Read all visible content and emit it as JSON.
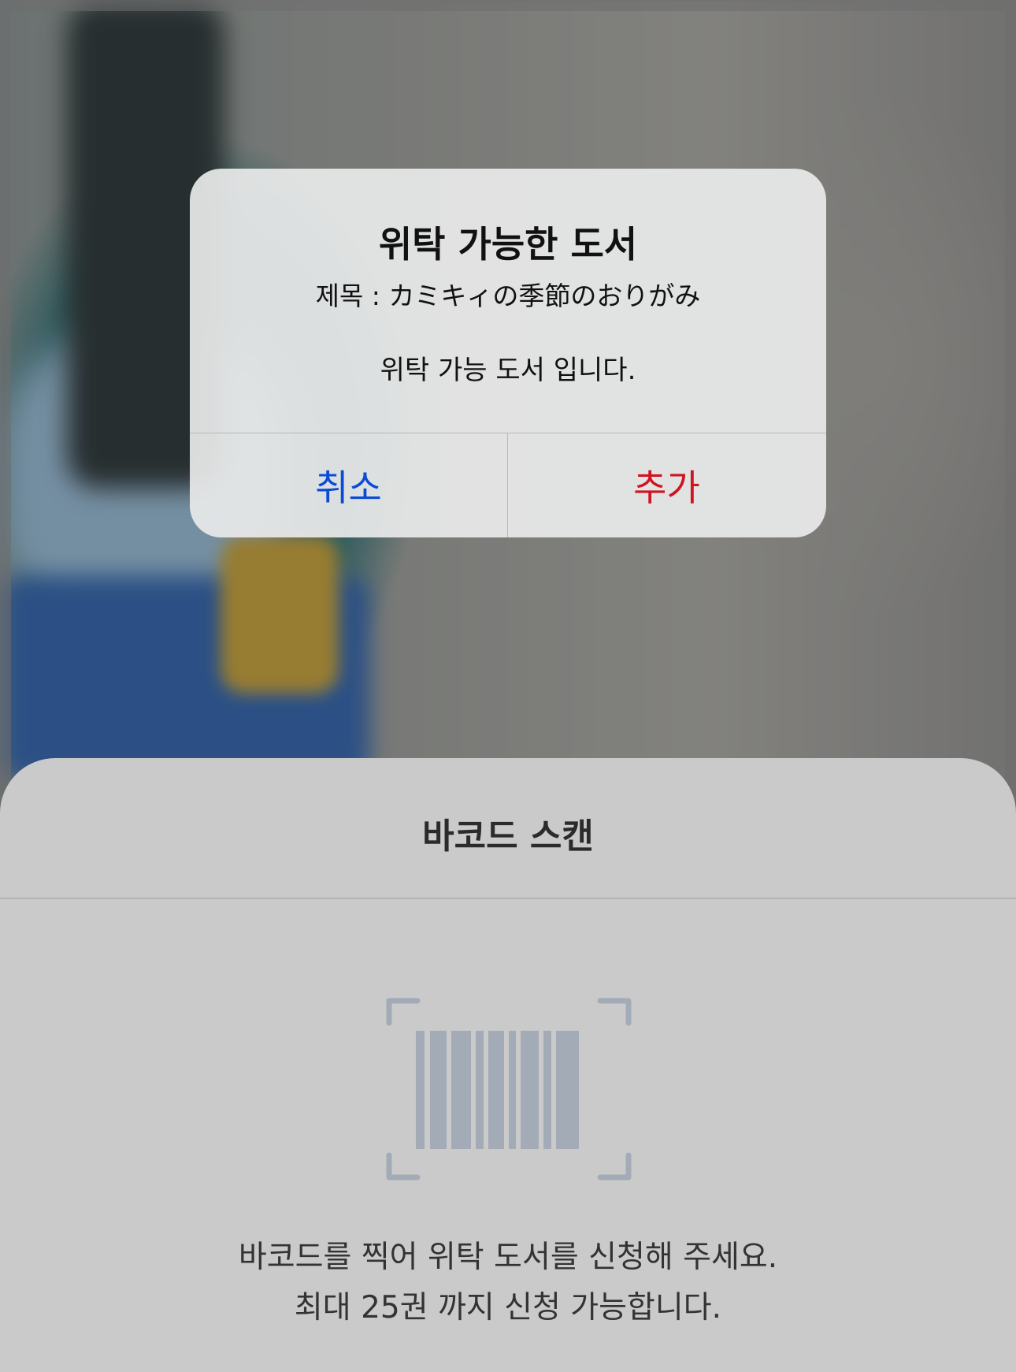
{
  "alert": {
    "title": "위탁 가능한 도서",
    "subtitle": "제목 : カミキィの季節のおりがみ",
    "message": "위탁 가능 도서 입니다.",
    "cancel_label": "취소",
    "add_label": "추가"
  },
  "sheet": {
    "title": "바코드 스캔",
    "instruction_line1": "바코드를 찍어 위탁 도서를 신청해 주세요.",
    "instruction_line2": "최대 25권 까지 신청 가능합니다."
  },
  "icons": {
    "barcode": "barcode-scan-icon"
  },
  "colors": {
    "cancel": "#0a4bd6",
    "add": "#d01320",
    "barcode": "#a3abb7"
  }
}
